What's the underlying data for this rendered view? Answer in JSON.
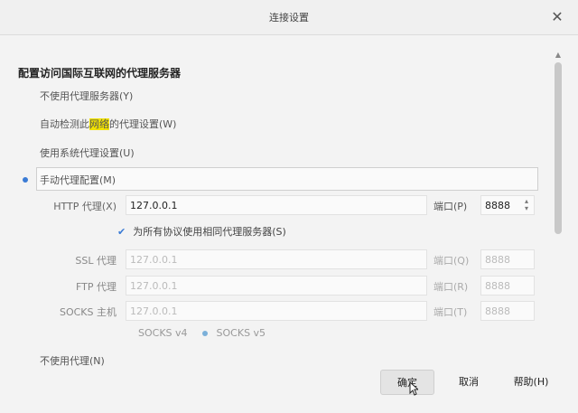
{
  "window": {
    "title": "连接设置",
    "close_glyph": "✕"
  },
  "heading": "配置访问国际互联网的代理服务器",
  "options": {
    "no_proxy": "不使用代理服务器(Y)",
    "auto_detect_pre": "自动检测此",
    "auto_detect_highlight": "网络",
    "auto_detect_post": "的代理设置(W)",
    "system": "使用系统代理设置(U)",
    "manual": "手动代理配置(M)",
    "selected": "manual"
  },
  "http": {
    "label": "HTTP 代理(X)",
    "value": "127.0.0.1",
    "port_label": "端口(P)",
    "port": "8888"
  },
  "share_checkbox": {
    "label": "为所有协议使用相同代理服务器(S)",
    "checked": true
  },
  "ssl": {
    "label": "SSL 代理",
    "value": "127.0.0.1",
    "port_label": "端口(Q)",
    "port": "8888"
  },
  "ftp": {
    "label": "FTP 代理",
    "value": "127.0.0.1",
    "port_label": "端口(R)",
    "port": "8888"
  },
  "socks": {
    "label": "SOCKS 主机",
    "value": "127.0.0.1",
    "port_label": "端口(T)",
    "port": "8888",
    "v4": "SOCKS v4",
    "v5": "SOCKS v5",
    "selected": "v5"
  },
  "no_proxy_for": "不使用代理(N)",
  "buttons": {
    "ok": "确定",
    "cancel": "取消",
    "help": "帮助(H)"
  },
  "colors": {
    "accent": "#3a7bd5",
    "highlight": "#f2e200"
  }
}
